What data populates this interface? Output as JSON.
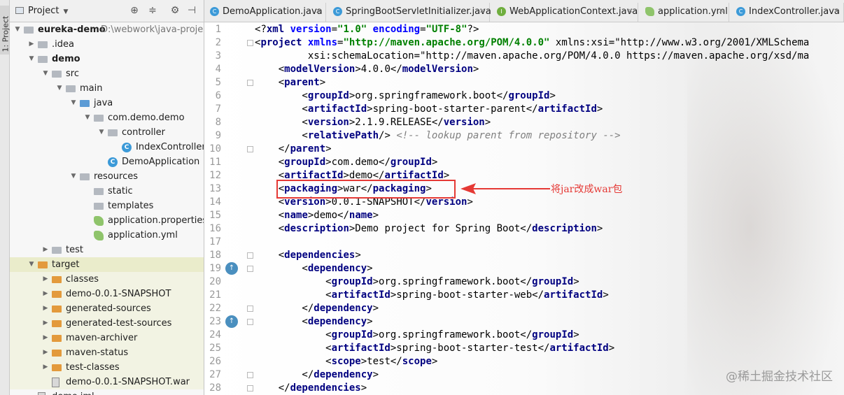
{
  "side_strip": {
    "label": "1: Project"
  },
  "project_panel": {
    "title": "Project",
    "tree": [
      {
        "label": "eureka-demo",
        "extra": "D:\\webwork\\java-project\\eure",
        "bold": true,
        "kind": "module"
      },
      {
        "label": ".idea",
        "kind": "folder"
      },
      {
        "label": "demo",
        "bold": true,
        "kind": "folder"
      },
      {
        "label": "src",
        "kind": "folder"
      },
      {
        "label": "main",
        "kind": "folder"
      },
      {
        "label": "java",
        "kind": "folder-blue"
      },
      {
        "label": "com.demo.demo",
        "kind": "package"
      },
      {
        "label": "controller",
        "kind": "package"
      },
      {
        "label": "IndexController",
        "kind": "class"
      },
      {
        "label": "DemoApplication",
        "kind": "class"
      },
      {
        "label": "resources",
        "kind": "folder-res"
      },
      {
        "label": "static",
        "kind": "folder"
      },
      {
        "label": "templates",
        "kind": "folder"
      },
      {
        "label": "application.properties",
        "kind": "config"
      },
      {
        "label": "application.yml",
        "kind": "config"
      },
      {
        "label": "test",
        "kind": "folder"
      },
      {
        "label": "target",
        "kind": "folder-orange"
      },
      {
        "label": "classes",
        "kind": "folder-orange"
      },
      {
        "label": "demo-0.0.1-SNAPSHOT",
        "kind": "folder-orange"
      },
      {
        "label": "generated-sources",
        "kind": "folder-orange"
      },
      {
        "label": "generated-test-sources",
        "kind": "folder-orange"
      },
      {
        "label": "maven-archiver",
        "kind": "folder-orange"
      },
      {
        "label": "maven-status",
        "kind": "folder-orange"
      },
      {
        "label": "test-classes",
        "kind": "folder-orange"
      },
      {
        "label": "demo-0.0.1-SNAPSHOT.war",
        "kind": "war"
      },
      {
        "label": "demo.iml",
        "kind": "file"
      }
    ]
  },
  "tabs": [
    {
      "label": "DemoApplication.java",
      "icon": "class-icon"
    },
    {
      "label": "SpringBootServletInitializer.java",
      "icon": "class-icon"
    },
    {
      "label": "WebApplicationContext.java",
      "icon": "interface-icon"
    },
    {
      "label": "application.yml",
      "icon": "yml-icon"
    },
    {
      "label": "IndexController.java",
      "icon": "class-icon"
    }
  ],
  "editor": {
    "line_numbers": [
      "1",
      "2",
      "3",
      "4",
      "5",
      "6",
      "7",
      "8",
      "9",
      "10",
      "11",
      "12",
      "13",
      "14",
      "15",
      "16",
      "17",
      "18",
      "19",
      "20",
      "21",
      "22",
      "23",
      "24",
      "25",
      "26",
      "27",
      "28"
    ],
    "lines": [
      "<?xml version=\"1.0\" encoding=\"UTF-8\"?>",
      "<project xmlns=\"http://maven.apache.org/POM/4.0.0\" xmlns:xsi=\"http://www.w3.org/2001/XMLSchema",
      "         xsi:schemaLocation=\"http://maven.apache.org/POM/4.0.0 https://maven.apache.org/xsd/ma",
      "    <modelVersion>4.0.0</modelVersion>",
      "    <parent>",
      "        <groupId>org.springframework.boot</groupId>",
      "        <artifactId>spring-boot-starter-parent</artifactId>",
      "        <version>2.1.9.RELEASE</version>",
      "        <relativePath/> <!-- lookup parent from repository -->",
      "    </parent>",
      "    <groupId>com.demo</groupId>",
      "    <artifactId>demo</artifactId>",
      "    <packaging>war</packaging>",
      "    <version>0.0.1-SNAPSHOT</version>",
      "    <name>demo</name>",
      "    <description>Demo project for Spring Boot</description>",
      "",
      "    <dependencies>",
      "        <dependency>",
      "            <groupId>org.springframework.boot</groupId>",
      "            <artifactId>spring-boot-starter-web</artifactId>",
      "        </dependency>",
      "        <dependency>",
      "            <groupId>org.springframework.boot</groupId>",
      "            <artifactId>spring-boot-starter-test</artifactId>",
      "            <scope>test</scope>",
      "        </dependency>",
      "    </dependencies>"
    ]
  },
  "annotation": {
    "text": "将jar改成war包",
    "color": "#e53935"
  },
  "watermark": "@稀土掘金技术社区"
}
